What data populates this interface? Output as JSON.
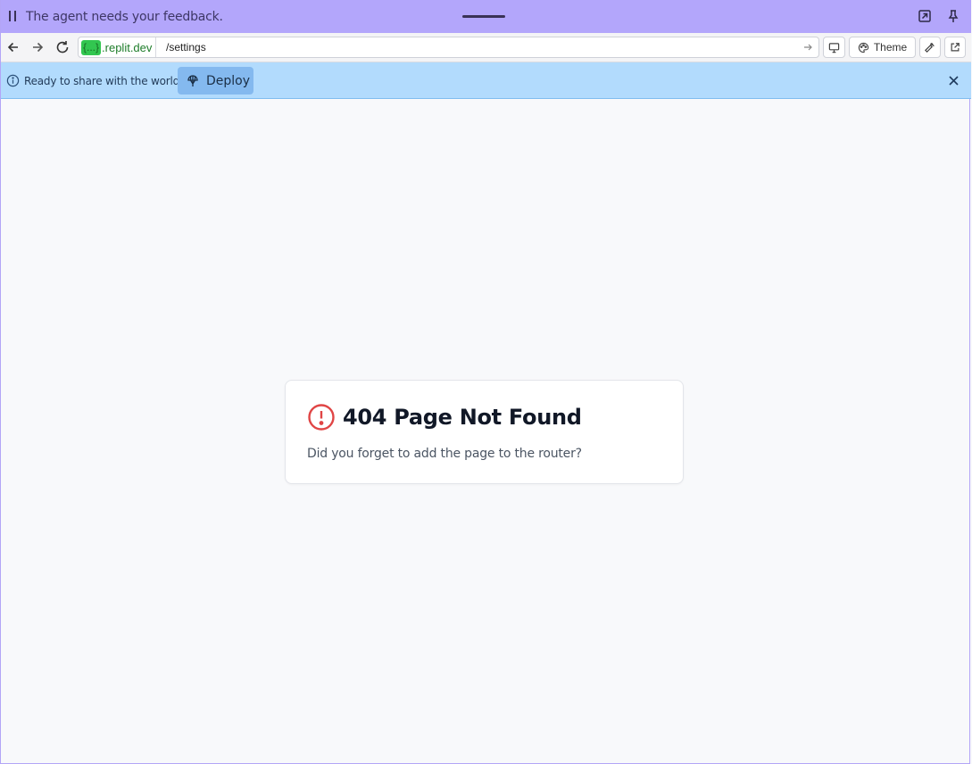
{
  "agent_bar": {
    "message": "The agent needs your feedback.",
    "icons": [
      "pause-icon",
      "drag-handle",
      "expand-icon",
      "pin-icon"
    ]
  },
  "browser": {
    "url_highlight": "{...}",
    "url_domain": ".replit.dev",
    "url_path": "/settings",
    "theme_label": "Theme"
  },
  "deploy_banner": {
    "question": "Ready to share with the world?",
    "deploy_label": "Deploy"
  },
  "error_card": {
    "title": "404 Page Not Found",
    "message": "Did you forget to add the page to the router?"
  },
  "colors": {
    "agent_bar_bg": "#b3a6fb",
    "deploy_bar_bg": "#b2dbfd",
    "deploy_button_bg": "#84b9ef",
    "url_highlight_bg": "#32c650",
    "error_red": "#e04545",
    "page_bg": "#f8f9fb"
  }
}
